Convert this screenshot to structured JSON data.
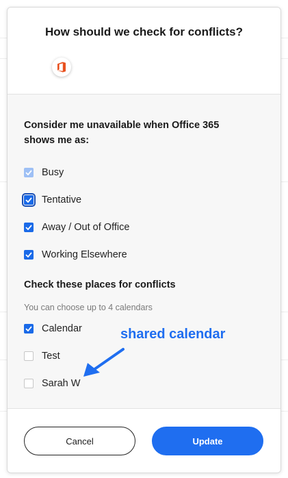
{
  "modal": {
    "title": "How should we check for conflicts?",
    "provider_icon": "office-365-icon",
    "availability": {
      "heading": "Consider me unavailable when Office 365 shows me as:",
      "options": [
        {
          "label": "Busy",
          "state": "checked-disabled"
        },
        {
          "label": "Tentative",
          "state": "checked-focused"
        },
        {
          "label": "Away / Out of Office",
          "state": "checked"
        },
        {
          "label": "Working Elsewhere",
          "state": "checked"
        }
      ]
    },
    "calendars": {
      "heading": "Check these places for conflicts",
      "hint": "You can choose up to 4 calendars",
      "options": [
        {
          "label": "Calendar",
          "state": "checked"
        },
        {
          "label": "Test",
          "state": "unchecked"
        },
        {
          "label": "Sarah W",
          "state": "unchecked"
        }
      ]
    },
    "annotation": "shared calendar",
    "buttons": {
      "cancel": "Cancel",
      "update": "Update"
    }
  },
  "colors": {
    "accent": "#1f6ef0",
    "office_orange": "#e8501e",
    "annotation": "#1f6ef0"
  }
}
